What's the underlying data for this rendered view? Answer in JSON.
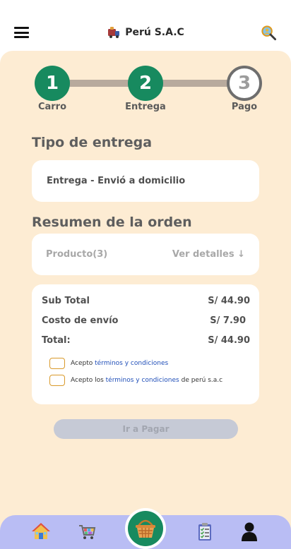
{
  "header": {
    "brand_name": "Perú S.A.C",
    "menu_icon": "hamburger-menu-icon",
    "search_icon": "search-icon"
  },
  "stepper": {
    "steps": [
      {
        "number": "1",
        "label": "Carro",
        "state": "done"
      },
      {
        "number": "2",
        "label": "Entrega",
        "state": "done"
      },
      {
        "number": "3",
        "label": "Pago",
        "state": "pending"
      }
    ]
  },
  "delivery": {
    "title": "Tipo de entrega",
    "value": "Entrega - Envió a domicilio"
  },
  "summary": {
    "title": "Resumen de la orden",
    "products_label": "Producto(3)",
    "details_link": "Ver detalles ↓",
    "rows": [
      {
        "label": "Sub Total",
        "value": "S/ 44.90"
      },
      {
        "label": "Costo de envío",
        "value": "S/ 7.90"
      },
      {
        "label": "Total:",
        "value": "S/ 44.90"
      }
    ],
    "terms1": {
      "prefix": "Acepto ",
      "link": "términos y condiciones",
      "suffix": ""
    },
    "terms2": {
      "prefix": "Acepto los ",
      "link": "términos y condiciones",
      "suffix": " de perú s.a.c"
    }
  },
  "actions": {
    "pay_label": "Ir a Pagar"
  },
  "bottom_nav": {
    "items": [
      "home-icon",
      "shopping-cart-icon",
      "basket-icon",
      "orders-clipboard-icon",
      "user-profile-icon"
    ]
  },
  "colors": {
    "sheet_bg": "#fdecd3",
    "accent_green": "#178a5f",
    "nav_bg": "#b9bdf4",
    "link_blue": "#1f4eb8",
    "checkbox_border": "#d99a2b"
  }
}
